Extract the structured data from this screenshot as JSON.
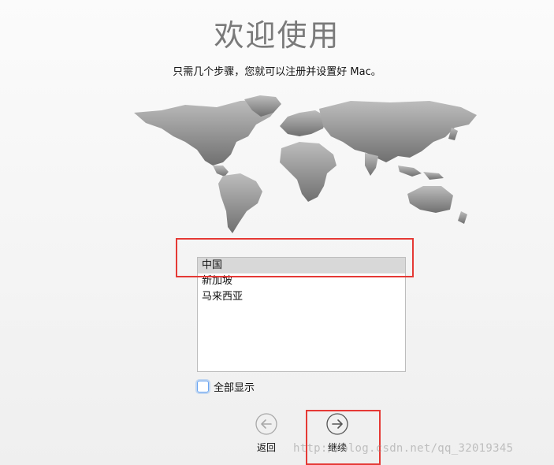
{
  "welcome": {
    "title": "欢迎使用",
    "subtitle": "只需几个步骤，您就可以注册并设置好 Mac。"
  },
  "region_list": {
    "items": [
      "中国",
      "新加坡",
      "马来西亚"
    ],
    "selected_index": 0
  },
  "show_all": {
    "label": "全部显示",
    "checked": false
  },
  "nav": {
    "back_label": "返回",
    "continue_label": "继续",
    "back_icon": "arrow-left-circle-icon",
    "continue_icon": "arrow-right-circle-icon"
  },
  "watermark": "http://blog.csdn.net/qq_32019345",
  "colors": {
    "highlight_box": "#e53935",
    "map_fill": "#8c8c8c",
    "title_gray": "#7a7a7a"
  }
}
